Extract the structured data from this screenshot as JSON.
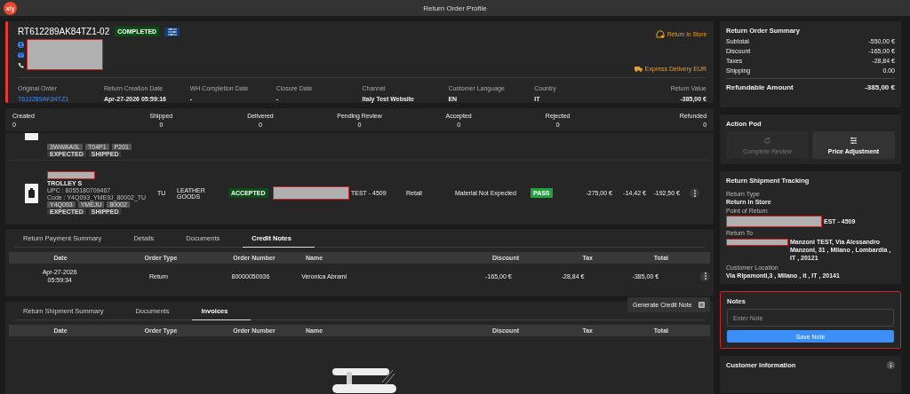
{
  "app_bar": {
    "title": "Return Order Profile",
    "logo": "x/y"
  },
  "header": {
    "order_id": "RT612289AK84TZ1-02",
    "status": "COMPLETED",
    "return_type": "Return In Store",
    "delivery": "Express Delivery EUR",
    "info": [
      {
        "label": "Original Order",
        "value": "T612289AK84TZ1",
        "kind": "link"
      },
      {
        "label": "Return Creation Date",
        "value": "Apr-27-2026 05:59:16",
        "kind": "text"
      },
      {
        "label": "WH Completion Date",
        "value": "-",
        "kind": "text"
      },
      {
        "label": "Closure Date",
        "value": "-",
        "kind": "text"
      },
      {
        "label": "Channel",
        "value": "Italy Test Website",
        "kind": "text"
      },
      {
        "label": "Customer Language",
        "value": "EN",
        "kind": "text"
      },
      {
        "label": "Country",
        "value": "IT",
        "kind": "text"
      },
      {
        "label": "Return Value",
        "value": "-385,00 €",
        "kind": "text"
      }
    ]
  },
  "counts": [
    {
      "label": "Created",
      "value": "0"
    },
    {
      "label": "Shipped",
      "value": "0"
    },
    {
      "label": "Delivered",
      "value": "0"
    },
    {
      "label": "Pending Review",
      "value": "0"
    },
    {
      "label": "Accepted",
      "value": "0"
    },
    {
      "label": "Rejected",
      "value": "0"
    },
    {
      "label": "Refunded",
      "value": "0"
    }
  ],
  "items": [
    {
      "kind": "partial",
      "tags": [
        "3WWAA0L",
        "T04P1",
        "P201"
      ],
      "flags": [
        "EXPECTED",
        "SHIPPED"
      ]
    },
    {
      "kind": "full",
      "name": "TROLLEY S",
      "upc": "UPC : 8055180709467",
      "code": "Code : Y4Q093_YME9J_80002_TU",
      "tags": [
        "Y4Q093",
        "YMEJU",
        "80002"
      ],
      "flags": [
        "EXPECTED",
        "SHIPPED"
      ],
      "size": "TU",
      "category": "LEATHER GOODS",
      "status": "ACCEPTED",
      "store": "TEST - 4509",
      "store_type": "Retail",
      "reason": "Material Not Expected",
      "check": "PASS",
      "price": "-275,00 €",
      "tax": "-14,42 €",
      "total": "-192,50 €"
    }
  ],
  "credit": {
    "tabs": [
      {
        "label": "Return Payment Summary",
        "selected": false
      },
      {
        "label": "Details",
        "selected": false
      },
      {
        "label": "Documents",
        "selected": false
      },
      {
        "label": "Credit Notes",
        "selected": true
      }
    ],
    "columns": [
      "Date",
      "Order Type",
      "Order Number",
      "Name",
      "Discount",
      "Tax",
      "Total"
    ],
    "rows": [
      {
        "date": "Apr-27-2026",
        "time": "05:59:34",
        "type": "Return",
        "number": "80000050936",
        "name": "Veronica Abrami",
        "discount": "-165,00 €",
        "tax": "-28,84 €",
        "total": "-385,00 €"
      }
    ],
    "menu": {
      "label": "Generate Credit Note"
    }
  },
  "invoices": {
    "tabs": [
      {
        "label": "Return Shipment Summary",
        "selected": false
      },
      {
        "label": "Documents",
        "selected": false
      },
      {
        "label": "Invoices",
        "selected": true
      }
    ],
    "columns": [
      "Date",
      "Order Type",
      "Order Number",
      "Name",
      "Discount",
      "Tax",
      "Total"
    ]
  },
  "summary": {
    "title": "Return Order Summary",
    "lines": [
      {
        "label": "Subtotal",
        "value": "-550,00 €"
      },
      {
        "label": "Discount",
        "value": "-165,00 €"
      },
      {
        "label": "Taxes",
        "value": "-28,84 €"
      },
      {
        "label": "Shipping",
        "value": "0.00"
      }
    ],
    "total_label": "Refundable Amount",
    "total_value": "-385,00 €"
  },
  "action_pod": {
    "title": "Action Pod",
    "buttons": [
      {
        "label": "Complete Review",
        "disabled": true,
        "kind": "review"
      },
      {
        "label": "Price Adjustment",
        "disabled": false,
        "kind": "adjust"
      }
    ]
  },
  "tracking": {
    "title": "Return Shipment Tracking",
    "return_type_label": "Return Type",
    "return_type": "Return In Store",
    "point_label": "Point of Return",
    "point": "EST - 4509",
    "return_to_label": "Return To",
    "return_to": "Manzoni TEST, Via Alessandro Manzoni, 31 , Milano , Lombardia , IT , 20121",
    "location_label": "Customer Location",
    "location": "Via Ripamonti,3 , Milano , it , IT , 20141"
  },
  "notes": {
    "title": "Notes",
    "placeholder": "Enter Note",
    "button": "Save Note"
  },
  "customer": {
    "title": "Customer Information"
  }
}
